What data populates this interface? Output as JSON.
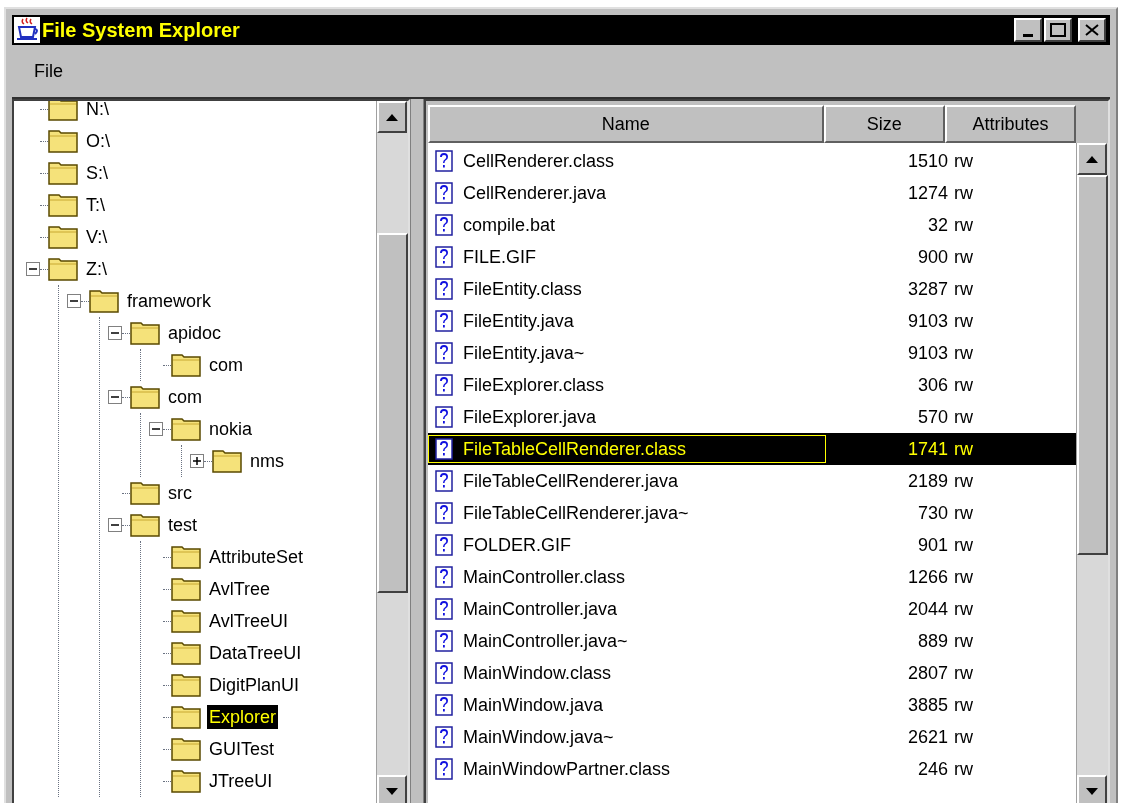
{
  "window": {
    "title": "File System Explorer"
  },
  "menu": [
    "File"
  ],
  "tree": [
    {
      "label": "N:\\",
      "selected": false
    },
    {
      "label": "O:\\",
      "selected": false
    },
    {
      "label": "S:\\",
      "selected": false
    },
    {
      "label": "T:\\",
      "selected": false
    },
    {
      "label": "V:\\",
      "selected": false
    },
    {
      "label": "Z:\\",
      "selected": false,
      "expanded": true,
      "children": [
        {
          "label": "framework",
          "selected": false,
          "expanded": true,
          "children": [
            {
              "label": "apidoc",
              "selected": false,
              "expanded": true,
              "children": [
                {
                  "label": "com",
                  "selected": false
                }
              ]
            },
            {
              "label": "com",
              "selected": false,
              "expanded": true,
              "children": [
                {
                  "label": "nokia",
                  "selected": false,
                  "expanded": true,
                  "children": [
                    {
                      "label": "nms",
                      "selected": false,
                      "expanded": false
                    }
                  ]
                }
              ]
            },
            {
              "label": "src",
              "selected": false
            },
            {
              "label": "test",
              "selected": false,
              "expanded": true,
              "children": [
                {
                  "label": "AttributeSet",
                  "selected": false
                },
                {
                  "label": "AvlTree",
                  "selected": false
                },
                {
                  "label": "AvlTreeUI",
                  "selected": false
                },
                {
                  "label": "DataTreeUI",
                  "selected": false
                },
                {
                  "label": "DigitPlanUI",
                  "selected": false
                },
                {
                  "label": "Explorer",
                  "selected": true
                },
                {
                  "label": "GUITest",
                  "selected": false
                },
                {
                  "label": "JTreeUI",
                  "selected": false
                }
              ]
            }
          ]
        }
      ]
    }
  ],
  "table": {
    "columns": [
      "Name",
      "Size",
      "Attributes"
    ],
    "rows": [
      {
        "name": "CellRenderer.class",
        "size": "1510",
        "attributes": "rw",
        "selected": false
      },
      {
        "name": "CellRenderer.java",
        "size": "1274",
        "attributes": "rw",
        "selected": false
      },
      {
        "name": "compile.bat",
        "size": "32",
        "attributes": "rw",
        "selected": false
      },
      {
        "name": "FILE.GIF",
        "size": "900",
        "attributes": "rw",
        "selected": false
      },
      {
        "name": "FileEntity.class",
        "size": "3287",
        "attributes": "rw",
        "selected": false
      },
      {
        "name": "FileEntity.java",
        "size": "9103",
        "attributes": "rw",
        "selected": false
      },
      {
        "name": "FileEntity.java~",
        "size": "9103",
        "attributes": "rw",
        "selected": false
      },
      {
        "name": "FileExplorer.class",
        "size": "306",
        "attributes": "rw",
        "selected": false
      },
      {
        "name": "FileExplorer.java",
        "size": "570",
        "attributes": "rw",
        "selected": false
      },
      {
        "name": "FileTableCellRenderer.class",
        "size": "1741",
        "attributes": "rw",
        "selected": true
      },
      {
        "name": "FileTableCellRenderer.java",
        "size": "2189",
        "attributes": "rw",
        "selected": false
      },
      {
        "name": "FileTableCellRenderer.java~",
        "size": "730",
        "attributes": "rw",
        "selected": false
      },
      {
        "name": "FOLDER.GIF",
        "size": "901",
        "attributes": "rw",
        "selected": false
      },
      {
        "name": "MainController.class",
        "size": "1266",
        "attributes": "rw",
        "selected": false
      },
      {
        "name": "MainController.java",
        "size": "2044",
        "attributes": "rw",
        "selected": false
      },
      {
        "name": "MainController.java~",
        "size": "889",
        "attributes": "rw",
        "selected": false
      },
      {
        "name": "MainWindow.class",
        "size": "2807",
        "attributes": "rw",
        "selected": false
      },
      {
        "name": "MainWindow.java",
        "size": "3885",
        "attributes": "rw",
        "selected": false
      },
      {
        "name": "MainWindow.java~",
        "size": "2621",
        "attributes": "rw",
        "selected": false
      },
      {
        "name": "MainWindowPartner.class",
        "size": "246",
        "attributes": "rw",
        "selected": false
      }
    ]
  }
}
